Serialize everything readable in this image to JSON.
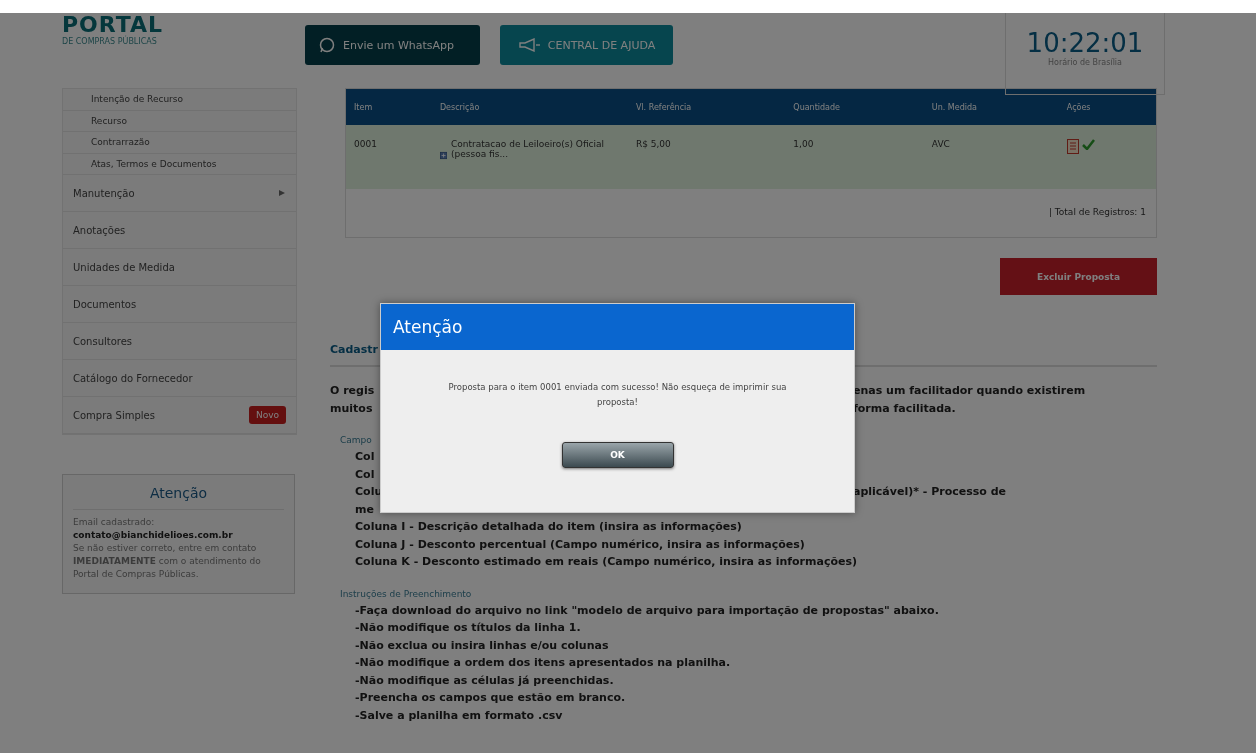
{
  "header": {
    "logo": {
      "title": "PORTAL",
      "subtitle": "DE COMPRAS PÚBLICAS"
    },
    "buttons": [
      {
        "label": "Envie um WhatsApp",
        "kind": "whatsapp"
      },
      {
        "label": "CENTRAL DE AJUDA",
        "kind": "help"
      }
    ],
    "clock": {
      "time": "10:22:01",
      "caption": "Horário de Brasília"
    }
  },
  "sidebar": {
    "items": [
      {
        "label": "Intenção de Recurso",
        "kind": "sub"
      },
      {
        "label": "Recurso",
        "kind": "sub"
      },
      {
        "label": "Contrarrazão",
        "kind": "sub"
      },
      {
        "label": "Atas, Termos e Documentos",
        "kind": "sub"
      },
      {
        "label": "Manutenção",
        "kind": "group"
      },
      {
        "label": "Anotações",
        "kind": "item"
      },
      {
        "label": "Unidades de Medida",
        "kind": "item"
      },
      {
        "label": "Documentos",
        "kind": "item"
      },
      {
        "label": "Consultores",
        "kind": "item"
      },
      {
        "label": "Catálogo do Fornecedor",
        "kind": "item"
      },
      {
        "label": "Compra Simples",
        "kind": "item",
        "badge": "Novo"
      }
    ],
    "notice": {
      "title": "Atenção",
      "label": "Email cadastrado:",
      "email": "contato@bianchidelioes.com.br",
      "text": "Se não estiver correto, entre em contato **IMEDIATAMENTE** com o atendimento do Portal de Compras Públicas."
    }
  },
  "table": {
    "columns": [
      "Item",
      "Descrição",
      "Vl. Referência",
      "Quantidade",
      "Un. Medida",
      "Ações"
    ],
    "rows": [
      {
        "cells": [
          "0001",
          "Contratacao de Leiloeiro(s) Oficial (pessoa fis...",
          "R$ 5,00",
          "1,00",
          "AVC"
        ]
      }
    ],
    "footer": "| Total de Registros: 1"
  },
  "delete_button": "Excluir Proposta",
  "section": {
    "title": "Cadastr",
    "intro": [
      {
        "start": "O regis",
        "end": "enas um facilitador quando existirem"
      },
      {
        "start": "muitos",
        "end": "forma facilitada."
      }
    ],
    "fields_title": "Campo",
    "fields": [
      {
        "start": "Col"
      },
      {
        "start": "Col"
      },
      {
        "start": "Colu",
        "end": "aplicável)* - Processo de"
      },
      {
        "start": "me"
      },
      {
        "start": "Coluna I - Descrição detalhada do item (insira as informações)"
      },
      {
        "start": "Coluna J - Desconto percentual (Campo numérico, insira as informações)"
      },
      {
        "start": "Coluna K - Desconto estimado em reais (Campo numérico, insira as informações)"
      }
    ],
    "instructions_title": "Instruções de Preenchimento",
    "instructions": [
      "-Faça download do arquivo no link \"modelo de arquivo para importação de propostas\" abaixo.",
      "-Não modifique os títulos da linha 1.",
      "-Não exclua ou insira linhas e/ou colunas",
      "-Não modifique a ordem dos itens apresentados na planilha.",
      "-Não modifique as células já preenchidas.",
      "-Preencha os campos que estão em branco.",
      "-Salve a planilha em formato .csv"
    ]
  },
  "dialog": {
    "title": "Atenção",
    "message": "Proposta para o item 0001 enviada com sucesso! Não esqueça de imprimir sua proposta!",
    "button": "OK"
  }
}
